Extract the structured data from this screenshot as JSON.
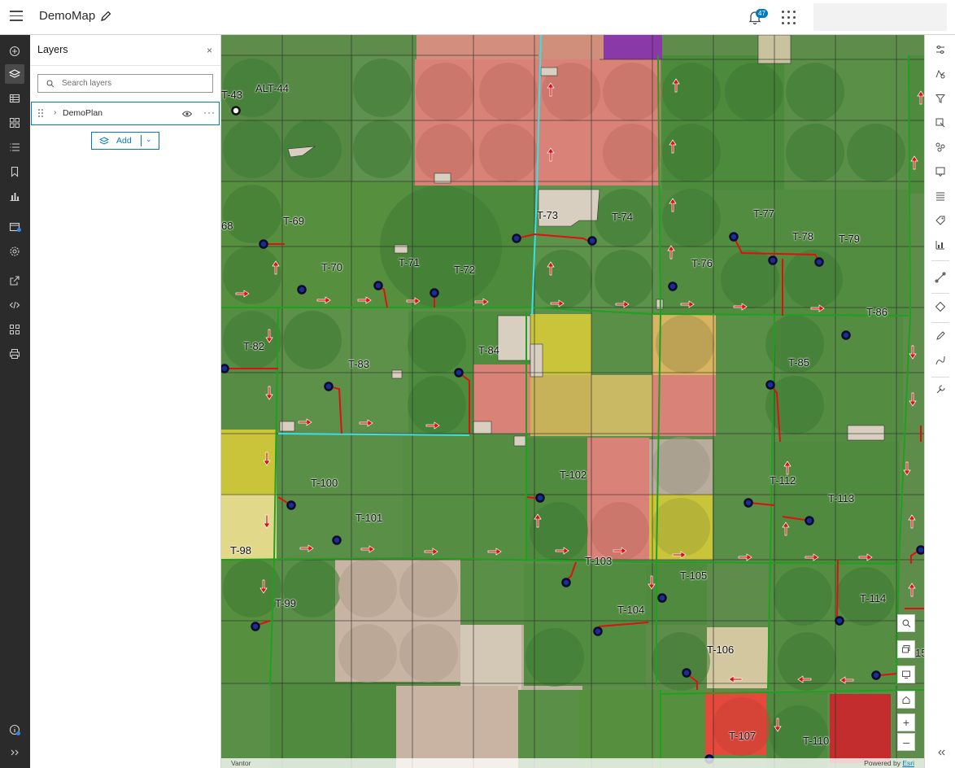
{
  "app": {
    "title": "DemoMap",
    "notifications_count": "47"
  },
  "layers_panel": {
    "title": "Layers",
    "close": "×",
    "search_placeholder": "Search layers",
    "layer": {
      "name": "DemoPlan"
    },
    "add_label": "Add"
  },
  "map": {
    "attribution_left": "Vantor",
    "attribution_right_prefix": "Powered by ",
    "attribution_right_link": "Esri",
    "tract_labels": [
      {
        "text": "T-43"
      },
      {
        "text": "ALT-44"
      },
      {
        "text": "T-69"
      },
      {
        "text": "68"
      },
      {
        "text": "T-70"
      },
      {
        "text": "T-71"
      },
      {
        "text": "T-72"
      },
      {
        "text": "T-73"
      },
      {
        "text": "T-74"
      },
      {
        "text": "T-77"
      },
      {
        "text": "T-78"
      },
      {
        "text": "T-79"
      },
      {
        "text": "T-76"
      },
      {
        "text": "T-86"
      },
      {
        "text": "T-82"
      },
      {
        "text": "T-83"
      },
      {
        "text": "T-84"
      },
      {
        "text": "T-85"
      },
      {
        "text": "T-100"
      },
      {
        "text": "T-101"
      },
      {
        "text": "T-102"
      },
      {
        "text": "T-112"
      },
      {
        "text": "T-113"
      },
      {
        "text": "T-98"
      },
      {
        "text": "T-103"
      },
      {
        "text": "T-105"
      },
      {
        "text": "T-99"
      },
      {
        "text": "T-104"
      },
      {
        "text": "T-114"
      },
      {
        "text": "T-106"
      },
      {
        "text": "T-107"
      },
      {
        "text": "T-110"
      },
      {
        "text": "15"
      }
    ]
  },
  "colors": {
    "accent": "#007ac2",
    "field_green": "#4f8a3e",
    "field_red": "#d98378",
    "field_yellow": "#c9c43a",
    "field_orange": "#d8b460",
    "field_purple": "#8a3aa8",
    "boundary_green": "#1fa01f",
    "boundary_cyan": "#34e2e8",
    "pipeline_red": "#e01010"
  }
}
